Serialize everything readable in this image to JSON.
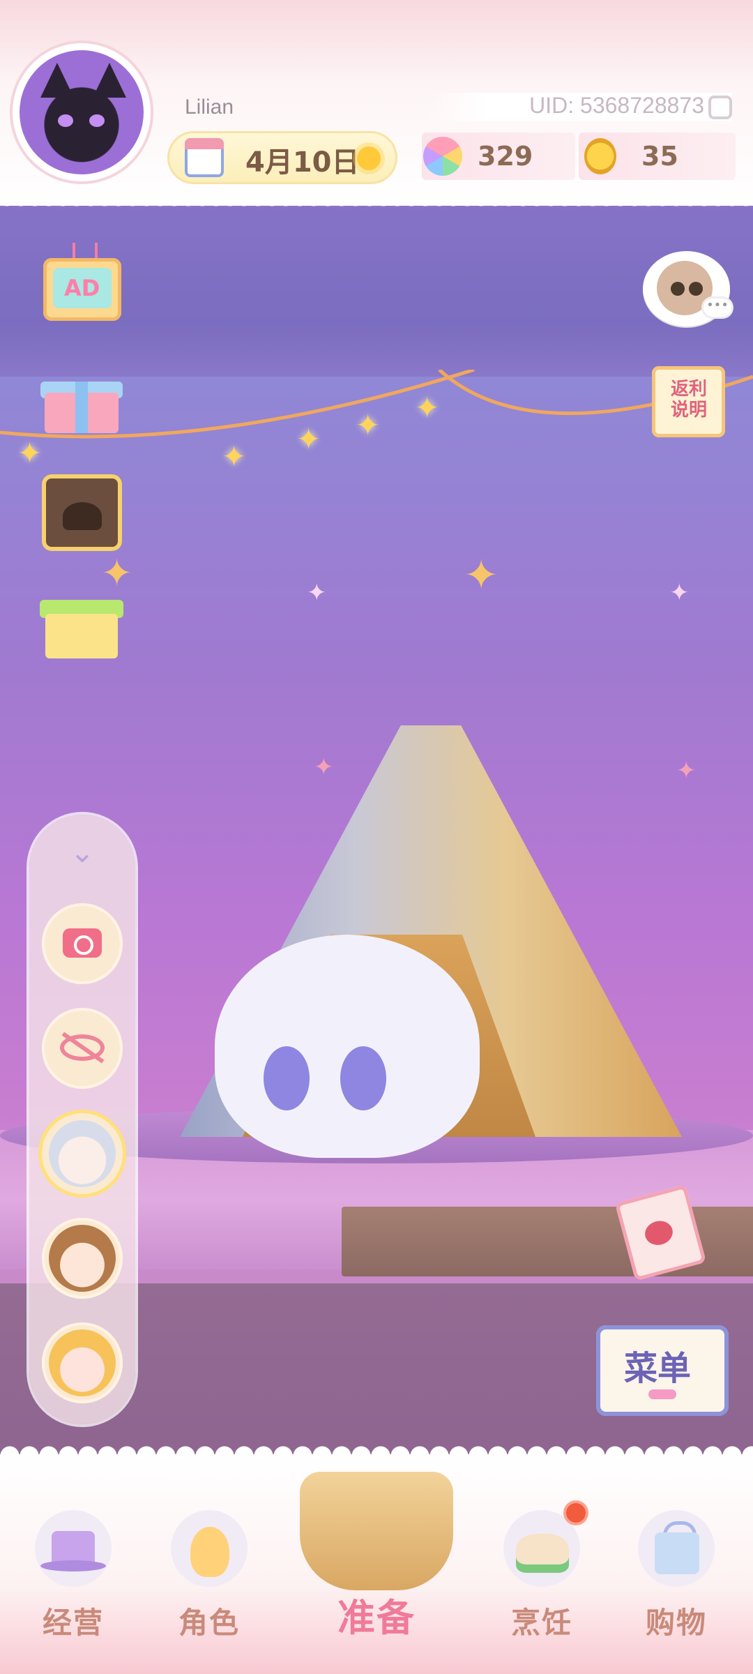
{
  "header": {
    "username": "Lilian",
    "uid": "UID: 5368728873",
    "date": "4月10日",
    "weather_icon": "sun-icon"
  },
  "currencies": [
    {
      "name": "rainbow-gem",
      "icon": "gem-icon",
      "value": "329"
    },
    {
      "name": "gold-coin",
      "icon": "coin-icon",
      "value": "35"
    }
  ],
  "side_events": {
    "ad_label": "AD",
    "rebate_label": "返利说明"
  },
  "menu_book_label": "菜单",
  "bottom_nav": [
    {
      "label": "经营",
      "icon": "top-hat-icon"
    },
    {
      "label": "角色",
      "icon": "duck-doll-icon"
    },
    {
      "label": "准备",
      "icon": "picnic-basket-icon"
    },
    {
      "label": "烹饪",
      "icon": "sandwich-icon",
      "badge": true
    },
    {
      "label": "购物",
      "icon": "shopping-bag-icon"
    }
  ],
  "colors": {
    "accent_pink": "#f07a9a",
    "nav_label": "#c98a7a",
    "badge_red": "#f15b3e",
    "wall_purple": "#b978d4"
  }
}
